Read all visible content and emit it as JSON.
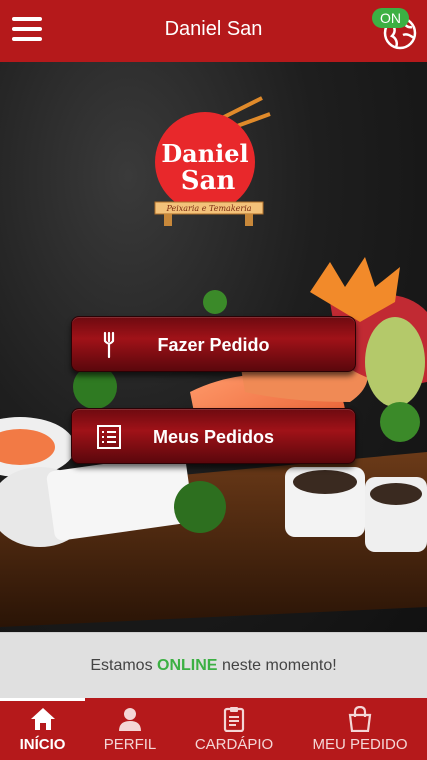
{
  "header": {
    "title": "Daniel San",
    "status_badge": "ON"
  },
  "logo": {
    "line1": "Daniel",
    "line2": "San",
    "tagline": "Peixaria e Temakeria"
  },
  "actions": {
    "order_label": "Fazer Pedido",
    "my_orders_label": "Meus Pedidos"
  },
  "status": {
    "prefix": "Estamos",
    "online": "ONLINE",
    "suffix": "neste momento!"
  },
  "nav": {
    "items": [
      {
        "label": "INÍCIO",
        "icon": "home-icon"
      },
      {
        "label": "PERFIL",
        "icon": "user-icon"
      },
      {
        "label": "CARDÁPIO",
        "icon": "clipboard-icon"
      },
      {
        "label": "MEU PEDIDO",
        "icon": "shopping-bag-icon"
      }
    ],
    "active_index": 0
  },
  "colors": {
    "brand_red": "#b5191b",
    "online_green": "#3cb043",
    "button_dark_red": "#8b0e14"
  }
}
